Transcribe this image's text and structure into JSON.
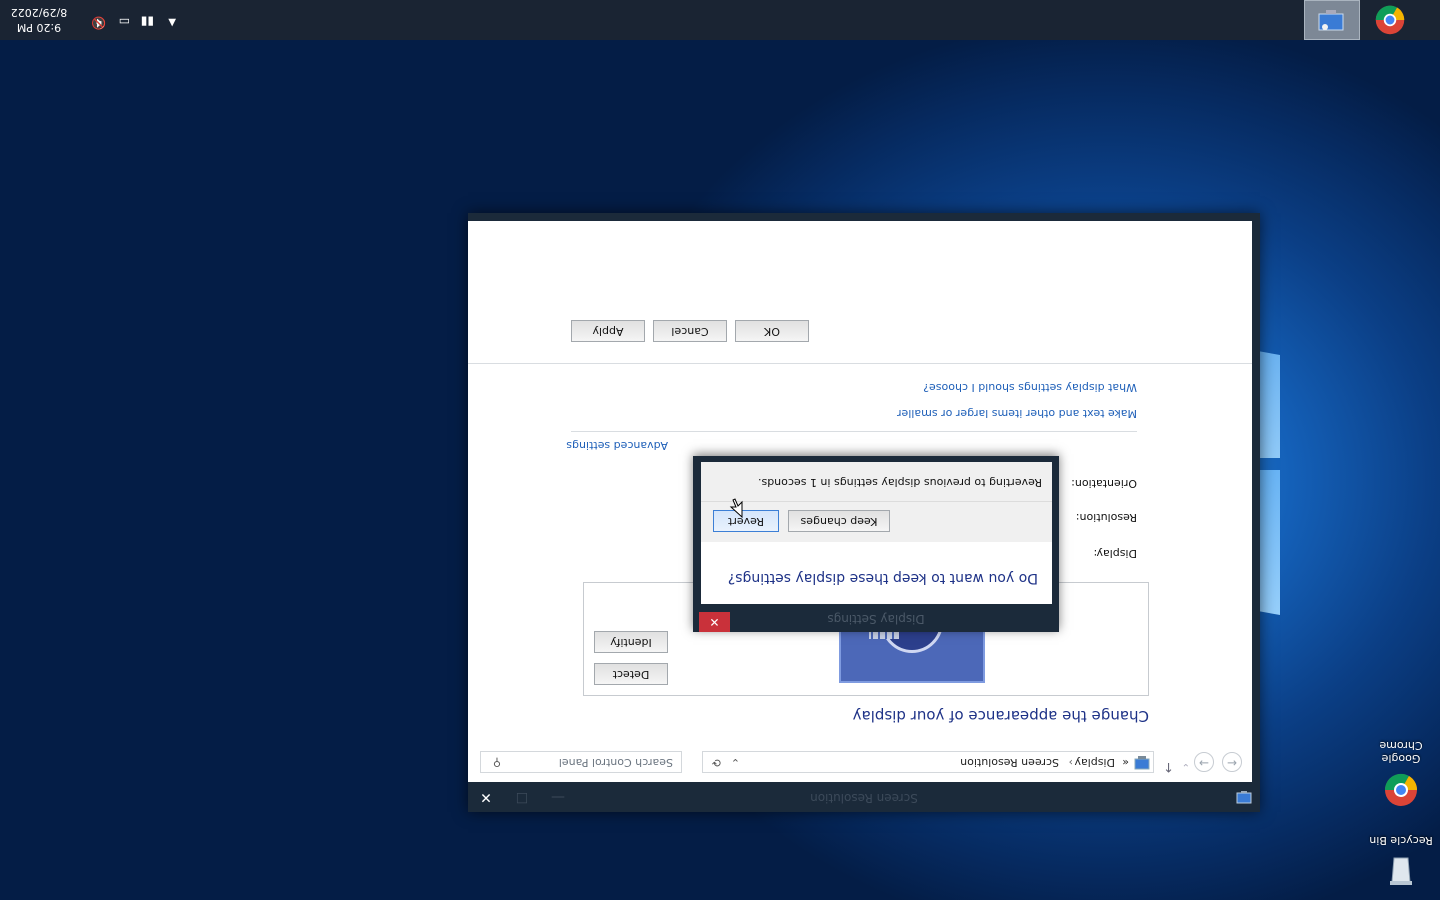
{
  "desktop": {
    "icons": [
      {
        "label": "Recycle Bin"
      },
      {
        "label": "Google Chrome"
      }
    ]
  },
  "taskbar": {
    "clock_time": "9:20 PM",
    "clock_date": "8/29/2022"
  },
  "window": {
    "title": "Screen Resolution",
    "minimize": "—",
    "maximize": "☐",
    "close": "✕",
    "address": {
      "path": [
        "Display",
        "Screen Resolution"
      ],
      "prefix": "«",
      "sep": "›",
      "search_placeholder": "Search Control Panel"
    },
    "heading": "Change the appearance of your display",
    "buttons": {
      "detect": "Detect",
      "identify": "Identify"
    },
    "labels": {
      "display": "Display:",
      "resolution": "Resolution:",
      "orientation": "Orientation:"
    },
    "links": {
      "advanced": "Advanced settings",
      "text_size": "Make text and other items larger or smaller",
      "which_settings": "What display settings should I choose?"
    },
    "footer_buttons": {
      "ok": "OK",
      "cancel": "Cancel",
      "apply": "Apply"
    }
  },
  "dialog": {
    "title": "Display Settings",
    "close": "✕",
    "question": "Do you want to keep these display settings?",
    "keep_label": "Keep changes",
    "revert_label": "Revert",
    "countdown": "Reverting to previous display settings in 1 seconds."
  }
}
